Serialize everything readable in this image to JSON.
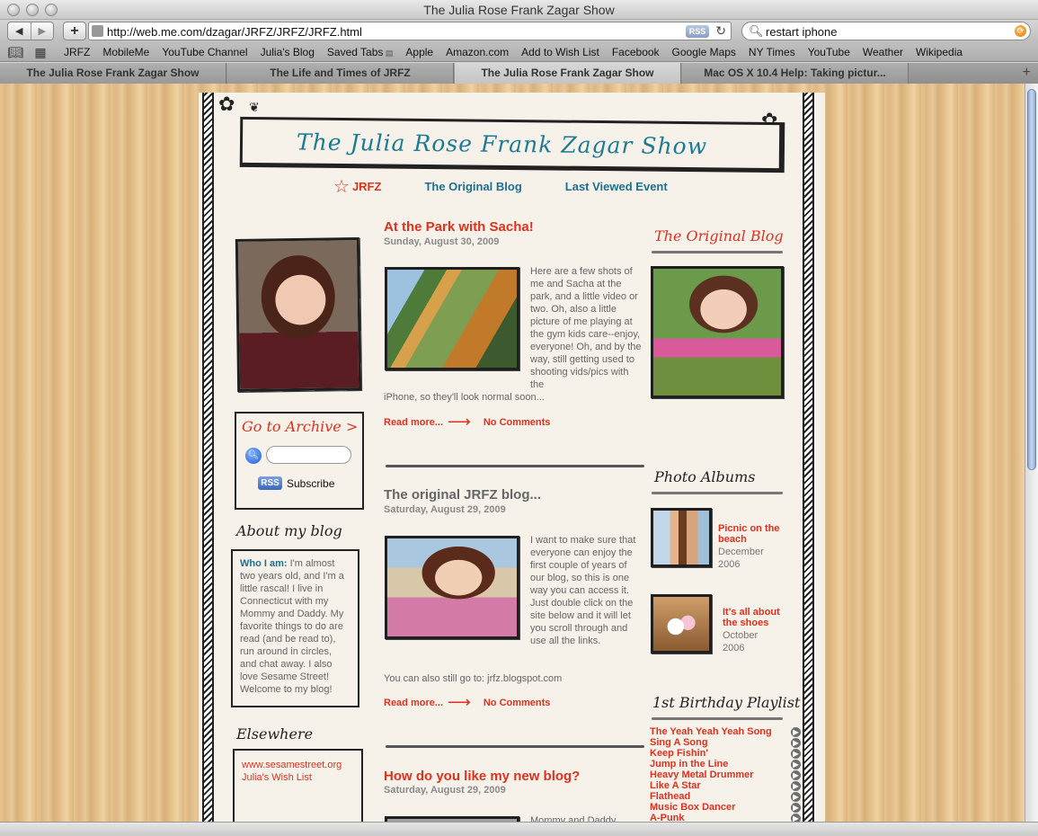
{
  "window": {
    "title": "The Julia Rose Frank Zagar Show"
  },
  "toolbar": {
    "url": "http://web.me.com/dzagar/JRFZ/JRFZ/JRFZ.html",
    "rss_label": "RSS",
    "search_value": "restart iphone"
  },
  "bookmarks": [
    "JRFZ",
    "MobileMe",
    "YouTube Channel",
    "Julia's Blog",
    "Saved Tabs",
    "Apple",
    "Amazon.com",
    "Add to Wish List",
    "Facebook",
    "Google Maps",
    "NY Times",
    "YouTube",
    "Weather",
    "Wikipedia"
  ],
  "tabs": [
    "The Julia Rose Frank Zagar Show",
    "The Life and Times of JRFZ",
    "The Julia Rose Frank Zagar Show",
    "Mac OS X 10.4 Help: Taking pictur..."
  ],
  "site": {
    "title": "The Julia Rose Frank Zagar Show",
    "nav": [
      "JRFZ",
      "The Original Blog",
      "Last Viewed Event"
    ]
  },
  "sidebar": {
    "archive_title": "Go to Archive >",
    "subscribe_label": "Subscribe",
    "rss_label": "RSS",
    "about_heading": "About my blog",
    "about_lead": "Who I am:",
    "about_text": " I'm almost two years old, and I'm a little rascal!  I live in Connecticut with my Mommy and Daddy.  My favorite things to do are read (and be read to), run around in circles, and chat away.  I also love Sesame Street!  Welcome to my blog!",
    "elsewhere_heading": "Elsewhere",
    "links": [
      "www.sesamestreet.org",
      "Julia's Wish List"
    ]
  },
  "posts": [
    {
      "title": "At the Park with Sacha!",
      "date": "Sunday, August 30, 2009",
      "text": "Here are a few shots of me and Sacha at the park, and a little video or two. Oh, also a little picture of me playing at the gym kids care--enjoy, everyone! Oh, and by the way, still getting used to shooting vids/pics with the",
      "text_tail": "iPhone, so they'll look normal soon...",
      "read_more": "Read more...",
      "comments": "No Comments"
    },
    {
      "title": "The original JRFZ blog...",
      "date": "Saturday, August 29, 2009",
      "text": "I want to make sure that everyone can enjoy the first couple of years of our blog, so this is one way you can access it. Just double click on the site below and it will let you scroll through and use all the links.",
      "text_tail": "You can also still go to: jrfz.blogspot.com",
      "read_more": "Read more...",
      "comments": "No Comments"
    },
    {
      "title": "How do you like my new blog?",
      "date": "Saturday, August 29, 2009",
      "text": "Mommy and Daddy"
    }
  ],
  "right": {
    "original_blog_heading": "The Original Blog",
    "albums_heading": "Photo Albums",
    "albums": [
      {
        "title": "Picnic on the beach",
        "date": "December 2006"
      },
      {
        "title": "It's all about the shoes",
        "date": "October 2006"
      }
    ],
    "playlist_heading": "1st Birthday Playlist",
    "songs": [
      "The Yeah Yeah Yeah Song",
      "Sing A Song",
      "Keep Fishin'",
      "Jump in the Line",
      "Heavy Metal Drummer",
      "Like A Star",
      "Flathead",
      "Music Box Dancer",
      "A-Punk"
    ]
  }
}
